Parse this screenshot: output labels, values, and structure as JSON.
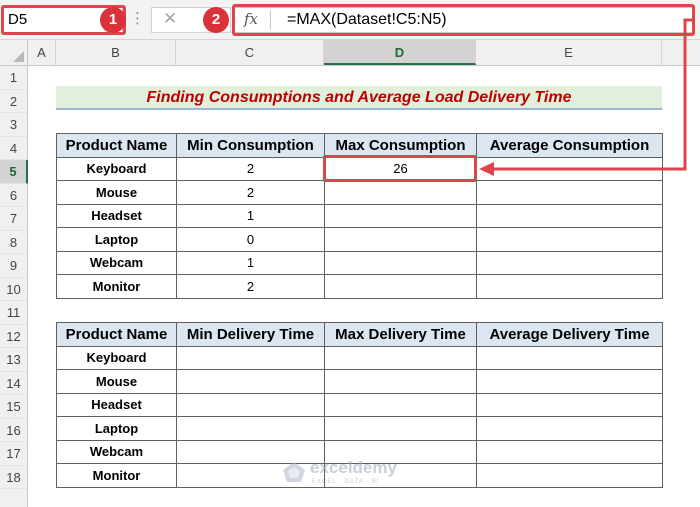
{
  "formula_bar": {
    "name_box": "D5",
    "name_box_badge": "1",
    "formula_badge": "2",
    "more_glyph": "⋮",
    "cancel_glyph": "✕",
    "fx_label": "fx",
    "formula": "=MAX(Dataset!C5:N5)"
  },
  "columns": [
    "A",
    "B",
    "C",
    "D",
    "E"
  ],
  "selected_column": "D",
  "rows": [
    "1",
    "2",
    "3",
    "4",
    "5",
    "6",
    "7",
    "8",
    "9",
    "10",
    "11",
    "12",
    "13",
    "14",
    "15",
    "16",
    "17",
    "18"
  ],
  "selected_row": "5",
  "title": "Finding Consumptions and Average Load Delivery Time",
  "consumption_table": {
    "headers": [
      "Product Name",
      "Min Consumption",
      "Max Consumption",
      "Average Consumption"
    ],
    "rows": [
      [
        "Keyboard",
        "2",
        "26",
        ""
      ],
      [
        "Mouse",
        "2",
        "",
        ""
      ],
      [
        "Headset",
        "1",
        "",
        ""
      ],
      [
        "Laptop",
        "0",
        "",
        ""
      ],
      [
        "Webcam",
        "1",
        "",
        ""
      ],
      [
        "Monitor",
        "2",
        "",
        ""
      ]
    ]
  },
  "delivery_table": {
    "headers": [
      "Product Name",
      "Min Delivery Time",
      "Max Delivery Time",
      "Average Delivery Time"
    ],
    "rows": [
      [
        "Keyboard",
        "",
        "",
        ""
      ],
      [
        "Mouse",
        "",
        "",
        ""
      ],
      [
        "Headset",
        "",
        "",
        ""
      ],
      [
        "Laptop",
        "",
        "",
        ""
      ],
      [
        "Webcam",
        "",
        "",
        ""
      ],
      [
        "Monitor",
        "",
        "",
        ""
      ]
    ]
  },
  "watermark": {
    "name": "exceldemy",
    "tagline": "EXCEL · DATA · BI"
  },
  "colors": {
    "highlight": "#e0434b",
    "badge": "#d9323b",
    "title_text": "#c00000",
    "title_fill": "#e2efda",
    "header_fill": "#dce6f1",
    "excel_green": "#217346"
  }
}
